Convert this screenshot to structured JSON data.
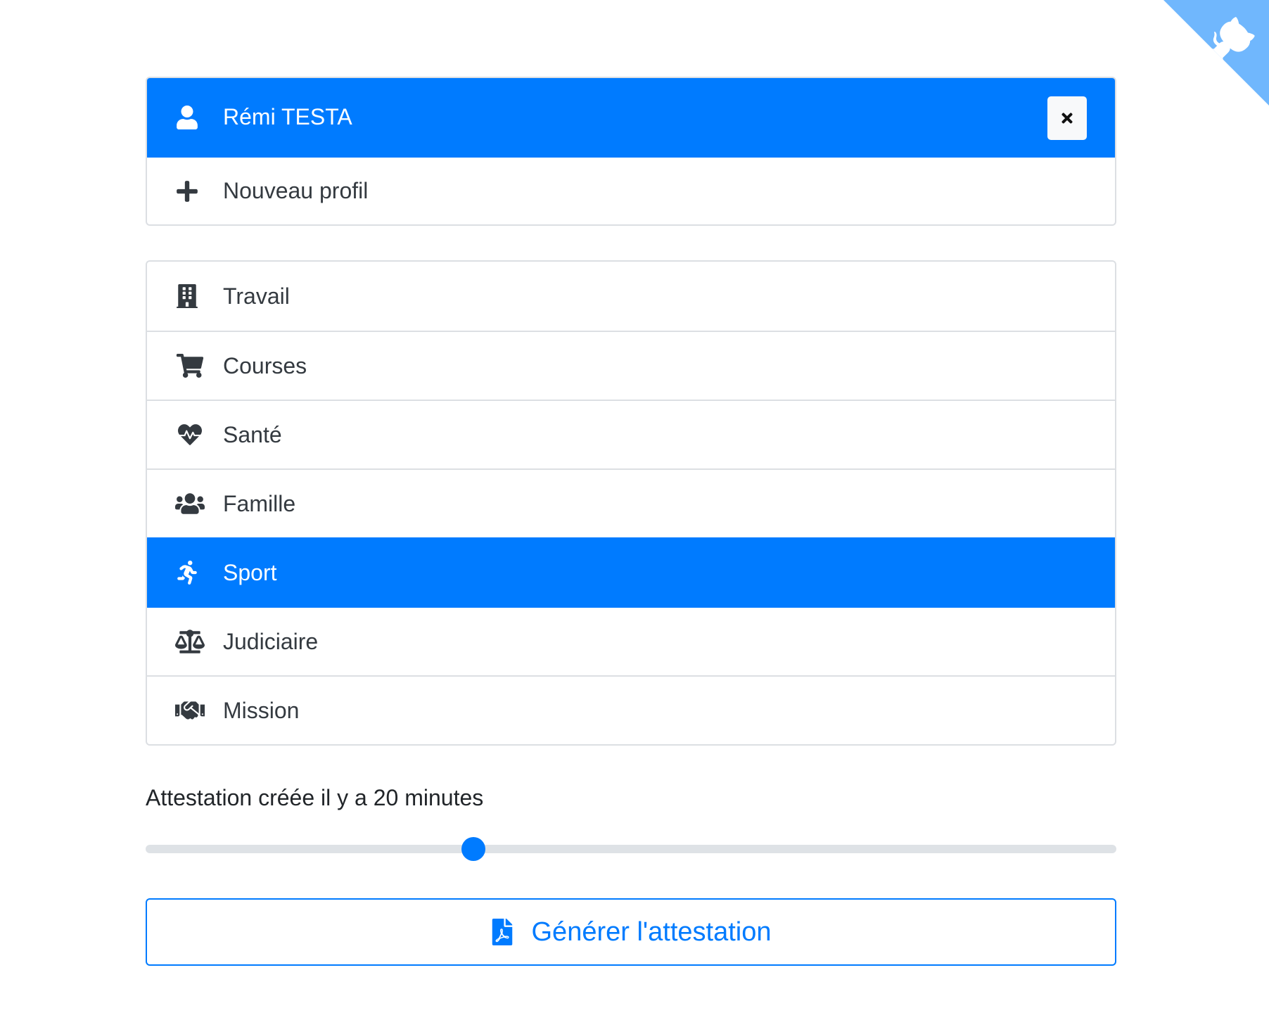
{
  "colors": {
    "primary": "#007bff",
    "border": "#dcdfe3",
    "text": "#343a40",
    "github_corner": "#70b7fd"
  },
  "profiles": {
    "selected": {
      "name": "Rémi TESTA",
      "icon": "user-icon",
      "close_icon": "close-icon"
    },
    "new_profile": {
      "label": "Nouveau profil",
      "icon": "plus-icon"
    }
  },
  "reasons": {
    "items": [
      {
        "label": "Travail",
        "icon": "building-icon",
        "active": false
      },
      {
        "label": "Courses",
        "icon": "shopping-cart-icon",
        "active": false
      },
      {
        "label": "Santé",
        "icon": "heartbeat-icon",
        "active": false
      },
      {
        "label": "Famille",
        "icon": "users-icon",
        "active": false
      },
      {
        "label": "Sport",
        "icon": "running-icon",
        "active": true
      },
      {
        "label": "Judiciaire",
        "icon": "balance-scale-icon",
        "active": false
      },
      {
        "label": "Mission",
        "icon": "handshake-icon",
        "active": false
      }
    ]
  },
  "attestation": {
    "status_text": "Attestation créée il y a 20 minutes",
    "slider_fraction": 0.338
  },
  "generate_button": {
    "label": "Générer l'attestation",
    "icon": "file-pdf-icon"
  },
  "github_corner": {
    "icon": "github-octocat-icon"
  }
}
